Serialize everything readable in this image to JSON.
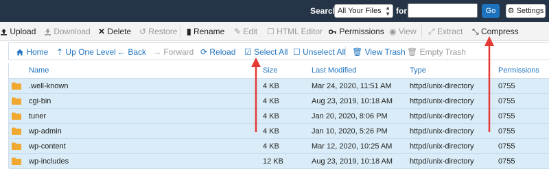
{
  "topbar": {
    "search_label": "Search",
    "search_scope": "All Your Files",
    "for_label": "for",
    "search_value": "",
    "go_label": "Go",
    "settings_label": "Settings"
  },
  "toolbar": {
    "items": [
      {
        "label": "Upload",
        "icon": "upload-icon",
        "enabled": true
      },
      {
        "label": "Download",
        "icon": "download-icon",
        "enabled": false
      },
      {
        "label": "Delete",
        "icon": "close-icon",
        "enabled": true
      },
      {
        "label": "Restore",
        "icon": "restore-icon",
        "enabled": false
      },
      {
        "label": "Rename",
        "icon": "rename-icon",
        "enabled": true
      },
      {
        "label": "Edit",
        "icon": "pencil-icon",
        "enabled": false
      },
      {
        "label": "HTML Editor",
        "icon": "html-editor-icon",
        "enabled": false
      },
      {
        "label": "Permissions",
        "icon": "key-icon",
        "enabled": true
      },
      {
        "label": "View",
        "icon": "eye-icon",
        "enabled": false
      },
      {
        "label": "Extract",
        "icon": "expand-icon",
        "enabled": false
      },
      {
        "label": "Compress",
        "icon": "compress-icon",
        "enabled": true
      }
    ]
  },
  "navbar": {
    "items": [
      {
        "label": "Home",
        "icon": "home-icon"
      },
      {
        "label": "Up One Level",
        "icon": "level-up-icon"
      },
      {
        "label": "Back",
        "icon": "arrow-left-icon"
      },
      {
        "label": "Forward",
        "icon": "arrow-right-icon"
      },
      {
        "label": "Reload",
        "icon": "reload-icon"
      },
      {
        "label": "Select All",
        "icon": "checkbox-checked-icon"
      },
      {
        "label": "Unselect All",
        "icon": "checkbox-empty-icon"
      },
      {
        "label": "View Trash",
        "icon": "trash-icon"
      },
      {
        "label": "Empty Trash",
        "icon": "trash-icon"
      }
    ]
  },
  "table": {
    "columns": [
      "Name",
      "Size",
      "Last Modified",
      "Type",
      "Permissions"
    ],
    "rows": [
      {
        "name": ".well-known",
        "size": "4 KB",
        "modified": "Mar 24, 2020, 11:51 AM",
        "type": "httpd/unix-directory",
        "perms": "0755"
      },
      {
        "name": "cgi-bin",
        "size": "4 KB",
        "modified": "Aug 23, 2019, 10:18 AM",
        "type": "httpd/unix-directory",
        "perms": "0755"
      },
      {
        "name": "tuner",
        "size": "4 KB",
        "modified": "Jan 20, 2020, 8:06 PM",
        "type": "httpd/unix-directory",
        "perms": "0755"
      },
      {
        "name": "wp-admin",
        "size": "4 KB",
        "modified": "Jan 10, 2020, 5:26 PM",
        "type": "httpd/unix-directory",
        "perms": "0755"
      },
      {
        "name": "wp-content",
        "size": "4 KB",
        "modified": "Mar 12, 2020, 10:25 AM",
        "type": "httpd/unix-directory",
        "perms": "0755"
      },
      {
        "name": "wp-includes",
        "size": "12 KB",
        "modified": "Aug 23, 2019, 10:18 AM",
        "type": "httpd/unix-directory",
        "perms": "0755"
      }
    ]
  },
  "colors": {
    "topbar": "#253446",
    "accent": "#1e73be",
    "row_selected": "#d9ecf7",
    "annotation_arrow": "#e53935",
    "folder": "#f0a830"
  }
}
